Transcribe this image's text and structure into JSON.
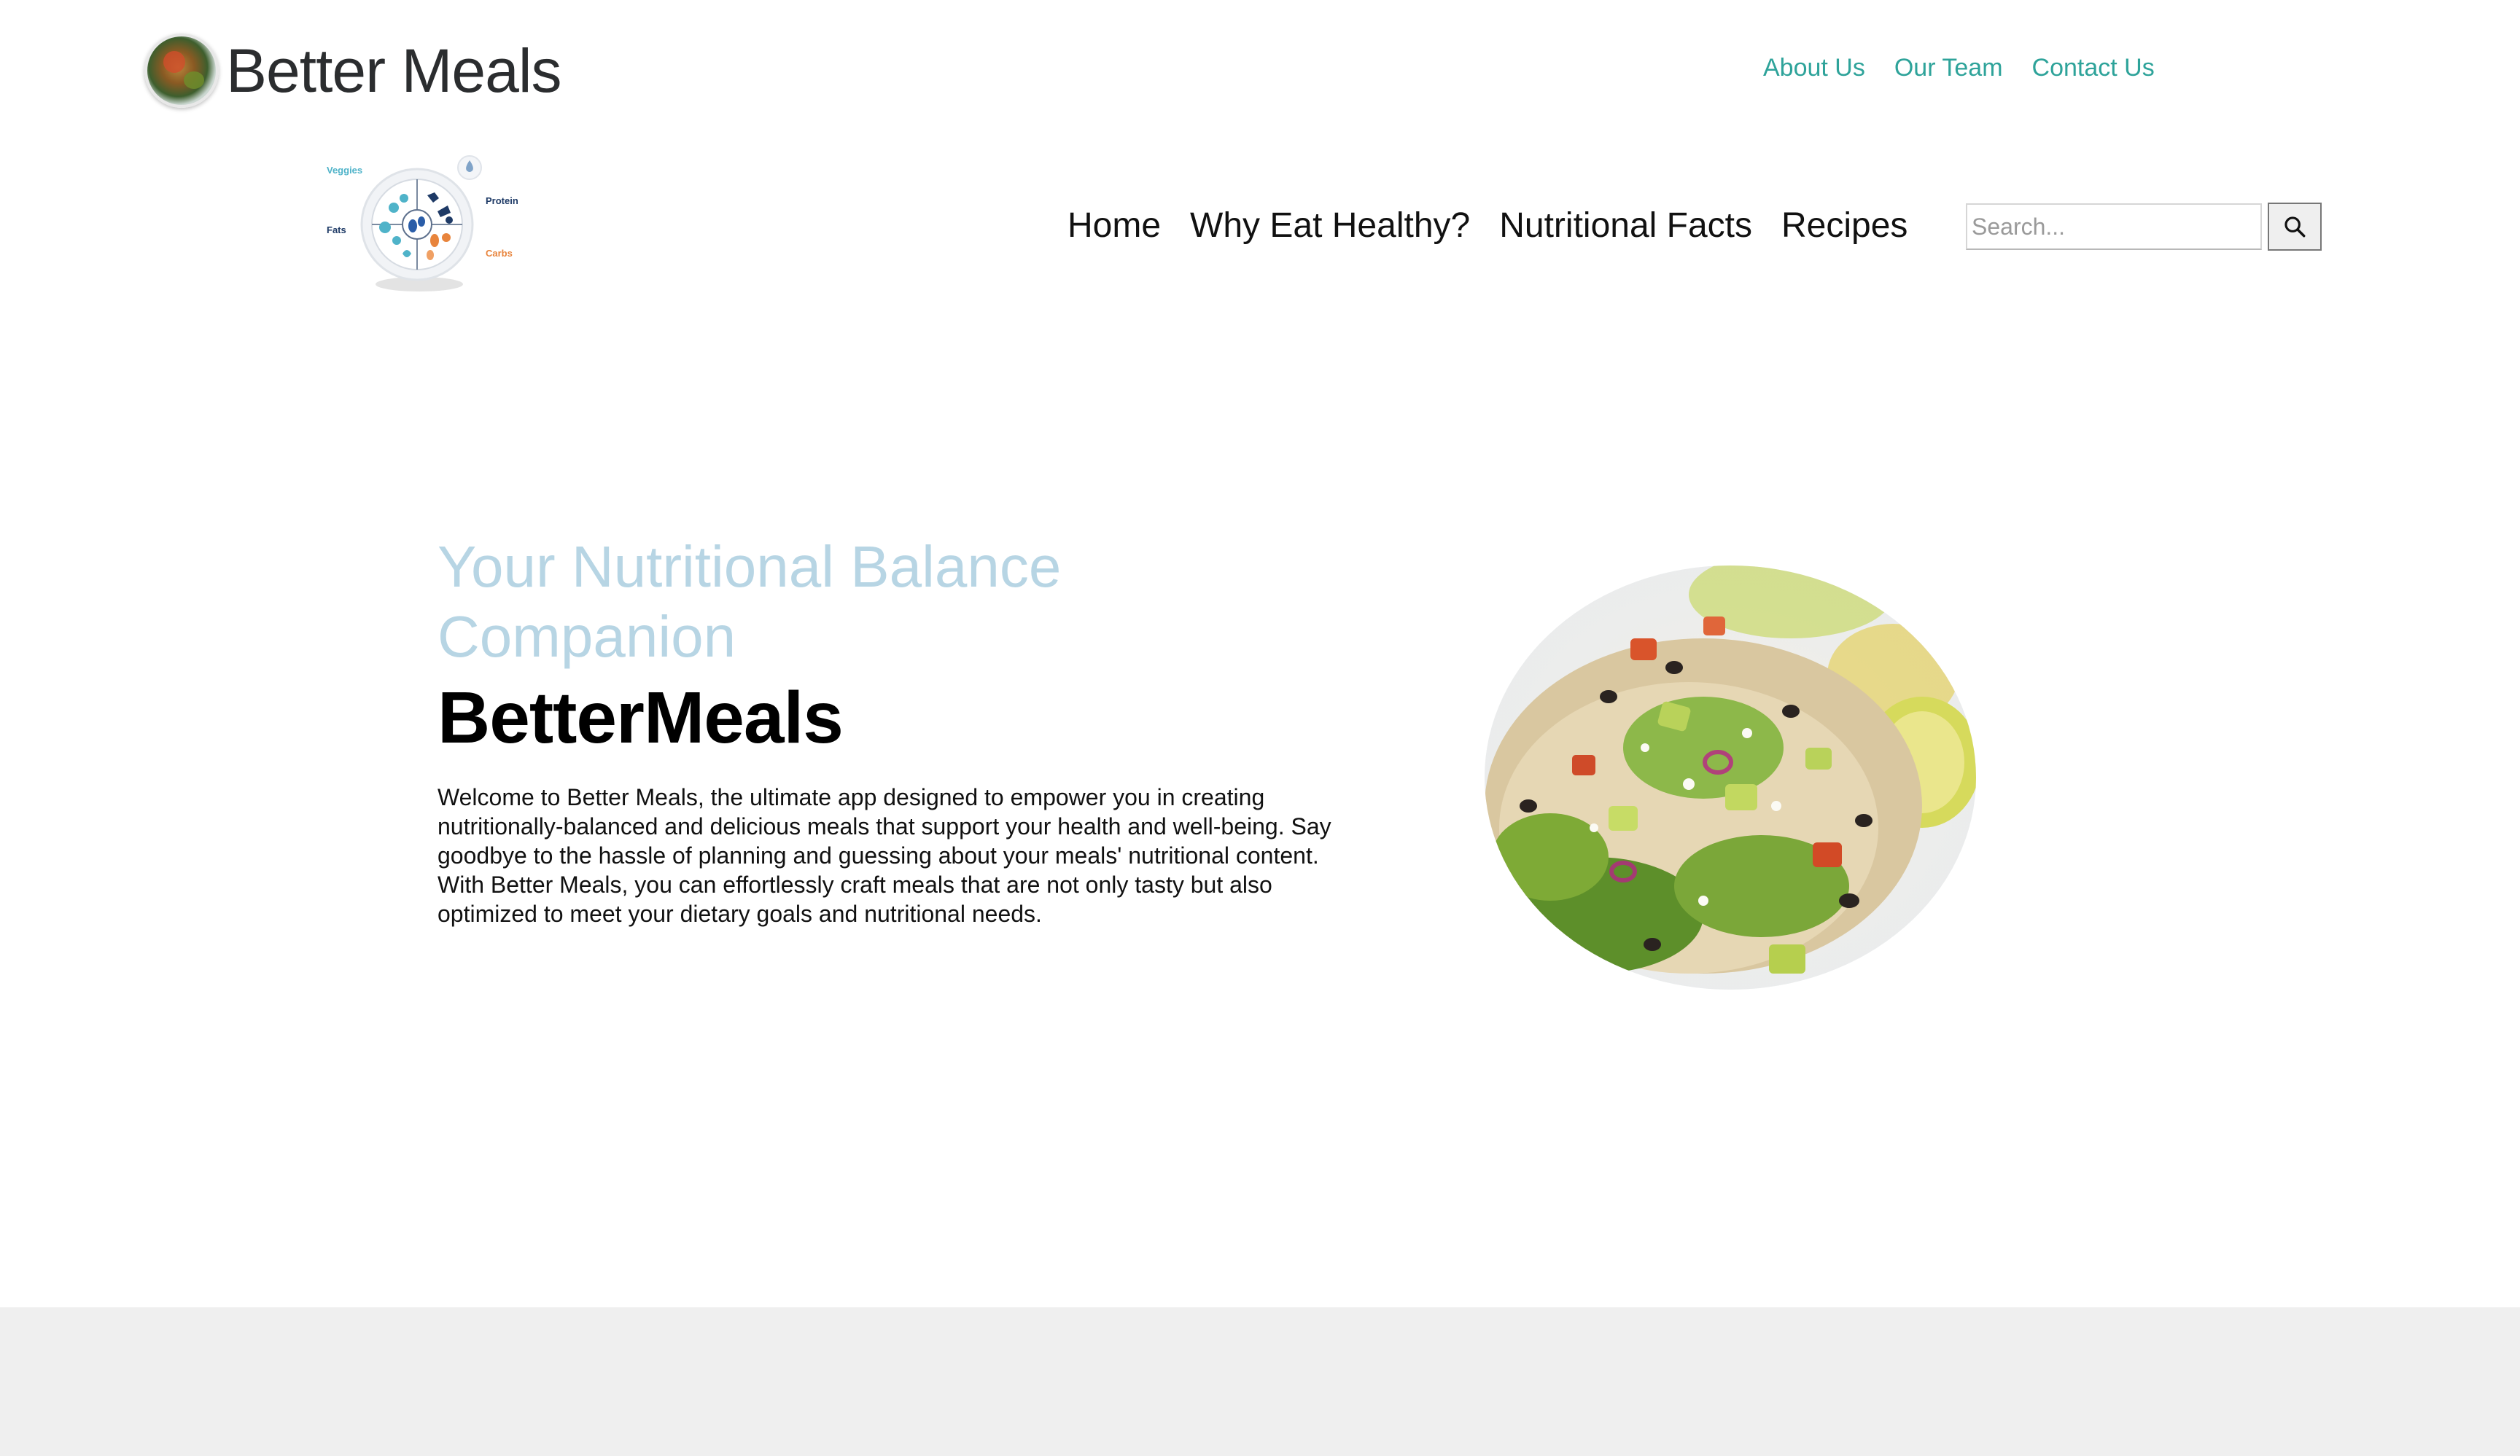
{
  "brand": {
    "title": "Better Meals"
  },
  "top_links": {
    "about": "About Us",
    "team": "Our Team",
    "contact": "Contact Us"
  },
  "nutri_logo": {
    "veggies": "Veggies",
    "protein": "Protein",
    "fats": "Fats",
    "carbs": "Carbs"
  },
  "main_nav": {
    "home": "Home",
    "why": "Why Eat Healthy?",
    "facts": "Nutritional Facts",
    "recipes": "Recipes"
  },
  "search": {
    "placeholder": "Search..."
  },
  "hero": {
    "tagline": "Your Nutritional Balance Companion",
    "title": "BetterMeals",
    "description": "Welcome to Better Meals, the ultimate app designed to empower you in creating nutritionally-balanced and delicious meals that support your health and well-being. Say goodbye to the hassle of planning and guessing about your meals' nutritional content. With Better Meals, you can effortlessly craft meals that are not only tasty but also optimized to meet your dietary goals and nutritional needs."
  },
  "colors": {
    "link_teal": "#2ea39a",
    "tagline_blue": "#b7d5e4",
    "footer_gray": "#efefef"
  }
}
